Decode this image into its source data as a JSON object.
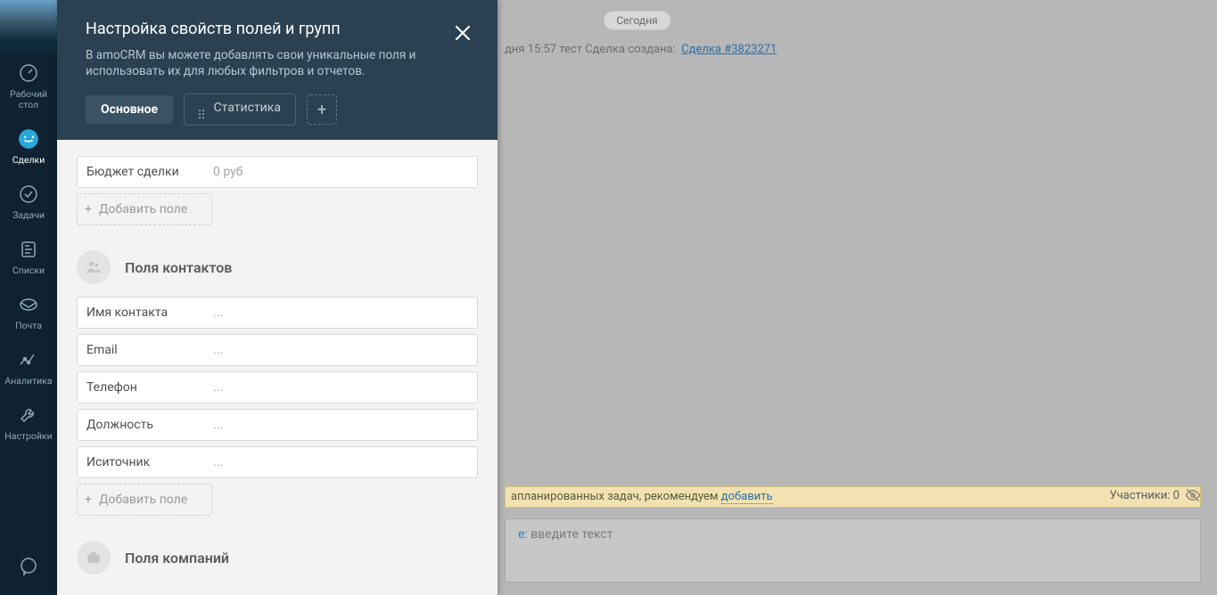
{
  "sidebar": {
    "items": [
      {
        "label": "Рабочий стол"
      },
      {
        "label": "Сделки"
      },
      {
        "label": "Задачи"
      },
      {
        "label": "Списки"
      },
      {
        "label": "Почта"
      },
      {
        "label": "Аналитика"
      },
      {
        "label": "Настройки"
      }
    ]
  },
  "bg": {
    "today": "Сегодня",
    "feed_time": "дня 15:57 тест  Сделка создана:",
    "feed_link": "Сделка #3823271",
    "task_text": "апланированных задач, рекомендуем ",
    "task_link": "добавить",
    "participants_label": "Участники: 0",
    "note_prefix": "е:",
    "note_placeholder": " введите текст"
  },
  "modal": {
    "title": "Настройка свойств полей и групп",
    "subtitle": "В amoCRM вы можете добавлять свои уникальные поля и использовать их для любых фильтров и отчетов.",
    "tabs": [
      {
        "label": "Основное"
      },
      {
        "label": "Статистика"
      }
    ],
    "budget": {
      "label": "Бюджет сделки",
      "value": "0 руб"
    },
    "add_field": "Добавить поле",
    "contact_section": "Поля контактов",
    "contact_fields": [
      {
        "label": "Имя контакта",
        "value": "..."
      },
      {
        "label": "Email",
        "value": "..."
      },
      {
        "label": "Телефон",
        "value": "..."
      },
      {
        "label": "Должность",
        "value": "..."
      },
      {
        "label": "Иситочник",
        "value": "..."
      }
    ],
    "company_section": "Поля компаний"
  }
}
